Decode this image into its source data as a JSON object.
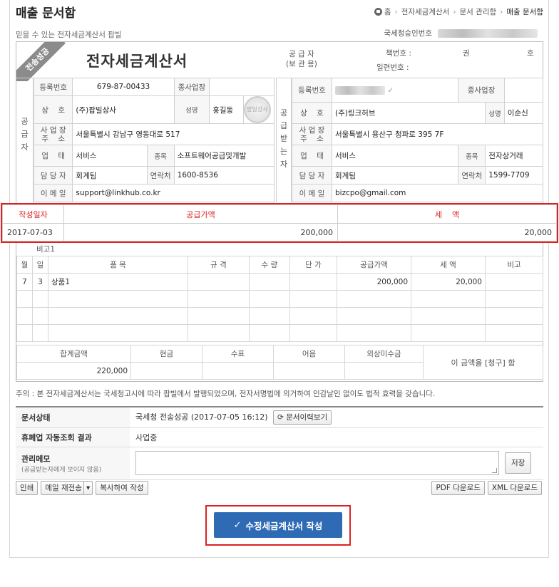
{
  "page": {
    "title": "매출 문서함",
    "subtitle": "믿을 수 있는 전자세금계산서 팝빌",
    "breadcrumb": [
      "홈",
      "전자세금계산서",
      "문서 관리함",
      "매출 문서함"
    ],
    "approval_label": "국세청승인번호"
  },
  "invoice": {
    "status_ribbon": "전송성공",
    "title": "전자세금계산서",
    "supplier_box_label": "공 급 자\n(보 관 용)",
    "book_no_label": "책번호 :",
    "serial_no_label": "일련번호 :",
    "book_gwon": "권",
    "book_ho": "호",
    "supplier_side": "공\n급\n자",
    "buyer_side": "공\n급\n받\n는\n자",
    "supplier": {
      "reg_label": "등록번호",
      "reg_value": "679-87-00433",
      "branch_label": "종사업장",
      "name_label": "상    호",
      "name_value": "(주)팝빌상사",
      "ceo_label": "성명",
      "ceo_value": "홍길동",
      "addr_label": "사 업 장\n주    소",
      "addr_value": "서울특별시 강남구 영동대로 517",
      "type_label": "업    태",
      "type_value": "서비스",
      "item_label": "종목",
      "item_value": "소프트웨어공급및개발",
      "contact_label": "담 당 자",
      "contact_value": "회계팀",
      "phone_label": "연락처",
      "phone_value": "1600-8536",
      "email_label": "이 메 일",
      "email_value": "support@linkhub.co.kr",
      "seal_text": "팝빌상사"
    },
    "buyer": {
      "reg_label": "등록번호",
      "branch_label": "종사업장",
      "name_label": "상    호",
      "name_value": "(주)링크허브",
      "ceo_label": "성명",
      "ceo_value": "이순신",
      "addr_label": "사 업 장\n주    소",
      "addr_value": "서울특별시 용산구 청파로 395 7F",
      "type_label": "업    태",
      "type_value": "서비스",
      "item_label": "종목",
      "item_value": "전자상거래",
      "contact_label": "담 당 자",
      "contact_value": "회계팀",
      "phone_label": "연락처",
      "phone_value": "1599-7709",
      "email_label": "이 메 일",
      "email_value": "bizcpo@gmail.com"
    },
    "summary": {
      "date_label": "작성일자",
      "supply_label": "공급가액",
      "tax_label": "세    액",
      "date_value": "2017-07-03",
      "supply_value": "200,000",
      "tax_value": "20,000"
    },
    "note_label": "비고1",
    "items_header": [
      "월",
      "일",
      "품 목",
      "규 격",
      "수 량",
      "단 가",
      "공급가액",
      "세 액",
      "비고"
    ],
    "items": [
      [
        "7",
        "3",
        "상품1",
        "",
        "",
        "",
        "200,000",
        "20,000",
        ""
      ]
    ],
    "totals": {
      "headers": [
        "합계금액",
        "현금",
        "수표",
        "어음",
        "외상미수금"
      ],
      "values": [
        "220,000",
        "",
        "",
        "",
        ""
      ],
      "claim_text": "이 금액을 [청구] 함"
    }
  },
  "notice": "주의 : 본 전자세금계산서는 국세청고시에 따라 팝빌에서 발행되었으며, 전자서명법에 의거하여 인감날인 없이도 법적 효력을 갖습니다.",
  "status": {
    "doc_status_label": "문서상태",
    "doc_status_value": "국세청 전송성공 (2017-07-05 16:12)",
    "history_button": "문서이력보기",
    "closure_label": "휴폐업 자동조회 결과",
    "closure_value": "사업중",
    "memo_label": "관리메모",
    "memo_sub": "(공급받는자에게 보이지 않음)",
    "memo_value": "",
    "save_button": "저장"
  },
  "actions": {
    "print": "인쇄",
    "resend_mail": "메일 재전송",
    "copy_create": "복사하여 작성",
    "pdf_download": "PDF 다운로드",
    "xml_download": "XML 다운로드",
    "primary": "수정세금계산서 작성"
  }
}
